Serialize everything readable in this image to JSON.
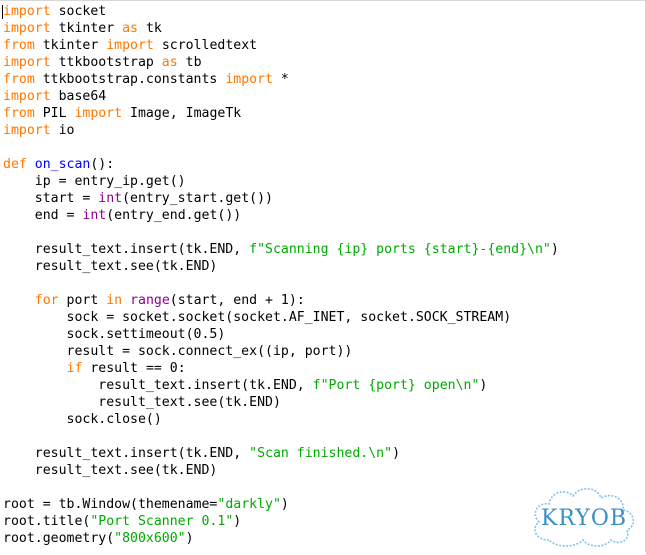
{
  "colors": {
    "keyword": "#ff7700",
    "builtin": "#900090",
    "string": "#00aa00",
    "definition": "#0000ff",
    "text": "#000000",
    "background": "#ffffff",
    "logo": "#3a8fc7"
  },
  "code_lines": [
    [
      [
        "kw",
        "import"
      ],
      [
        "p",
        " socket"
      ]
    ],
    [
      [
        "kw",
        "import"
      ],
      [
        "p",
        " tkinter "
      ],
      [
        "kw",
        "as"
      ],
      [
        "p",
        " tk"
      ]
    ],
    [
      [
        "kw",
        "from"
      ],
      [
        "p",
        " tkinter "
      ],
      [
        "kw",
        "import"
      ],
      [
        "p",
        " scrolledtext"
      ]
    ],
    [
      [
        "kw",
        "import"
      ],
      [
        "p",
        " ttkbootstrap "
      ],
      [
        "kw",
        "as"
      ],
      [
        "p",
        " tb"
      ]
    ],
    [
      [
        "kw",
        "from"
      ],
      [
        "p",
        " ttkbootstrap.constants "
      ],
      [
        "kw",
        "import"
      ],
      [
        "p",
        " *"
      ]
    ],
    [
      [
        "kw",
        "import"
      ],
      [
        "p",
        " base64"
      ]
    ],
    [
      [
        "kw",
        "from"
      ],
      [
        "p",
        " PIL "
      ],
      [
        "kw",
        "import"
      ],
      [
        "p",
        " Image, ImageTk"
      ]
    ],
    [
      [
        "kw",
        "import"
      ],
      [
        "p",
        " io"
      ]
    ],
    [],
    [
      [
        "kw",
        "def"
      ],
      [
        "p",
        " "
      ],
      [
        "def",
        "on_scan"
      ],
      [
        "p",
        "():"
      ]
    ],
    [
      [
        "p",
        "    ip = entry_ip.get()"
      ]
    ],
    [
      [
        "p",
        "    start = "
      ],
      [
        "bi",
        "int"
      ],
      [
        "p",
        "(entry_start.get())"
      ]
    ],
    [
      [
        "p",
        "    end = "
      ],
      [
        "bi",
        "int"
      ],
      [
        "p",
        "(entry_end.get())"
      ]
    ],
    [],
    [
      [
        "p",
        "    result_text.insert(tk.END, "
      ],
      [
        "str",
        "f\"Scanning {ip} ports {start}-{end}\\n\""
      ],
      [
        "p",
        ")"
      ]
    ],
    [
      [
        "p",
        "    result_text.see(tk.END)"
      ]
    ],
    [],
    [
      [
        "p",
        "    "
      ],
      [
        "kw",
        "for"
      ],
      [
        "p",
        " port "
      ],
      [
        "kw",
        "in"
      ],
      [
        "p",
        " "
      ],
      [
        "bi",
        "range"
      ],
      [
        "p",
        "(start, end + 1):"
      ]
    ],
    [
      [
        "p",
        "        sock = socket.socket(socket.AF_INET, socket.SOCK_STREAM)"
      ]
    ],
    [
      [
        "p",
        "        sock.settimeout(0.5)"
      ]
    ],
    [
      [
        "p",
        "        result = sock.connect_ex((ip, port))"
      ]
    ],
    [
      [
        "p",
        "        "
      ],
      [
        "kw",
        "if"
      ],
      [
        "p",
        " result == 0:"
      ]
    ],
    [
      [
        "p",
        "            result_text.insert(tk.END, "
      ],
      [
        "str",
        "f\"Port {port} open\\n\""
      ],
      [
        "p",
        ")"
      ]
    ],
    [
      [
        "p",
        "            result_text.see(tk.END)"
      ]
    ],
    [
      [
        "p",
        "        sock.close()"
      ]
    ],
    [],
    [
      [
        "p",
        "    result_text.insert(tk.END, "
      ],
      [
        "str",
        "\"Scan finished.\\n\""
      ],
      [
        "p",
        ")"
      ]
    ],
    [
      [
        "p",
        "    result_text.see(tk.END)"
      ]
    ],
    [],
    [
      [
        "p",
        "root = tb.Window(themename="
      ],
      [
        "str",
        "\"darkly\""
      ],
      [
        "p",
        ")"
      ]
    ],
    [
      [
        "p",
        "root.title("
      ],
      [
        "str",
        "\"Port Scanner 0.1\""
      ],
      [
        "p",
        ")"
      ]
    ],
    [
      [
        "p",
        "root.geometry("
      ],
      [
        "str",
        "\"800x600\""
      ],
      [
        "p",
        ")"
      ]
    ]
  ],
  "logo": {
    "text": "KRYOB"
  }
}
